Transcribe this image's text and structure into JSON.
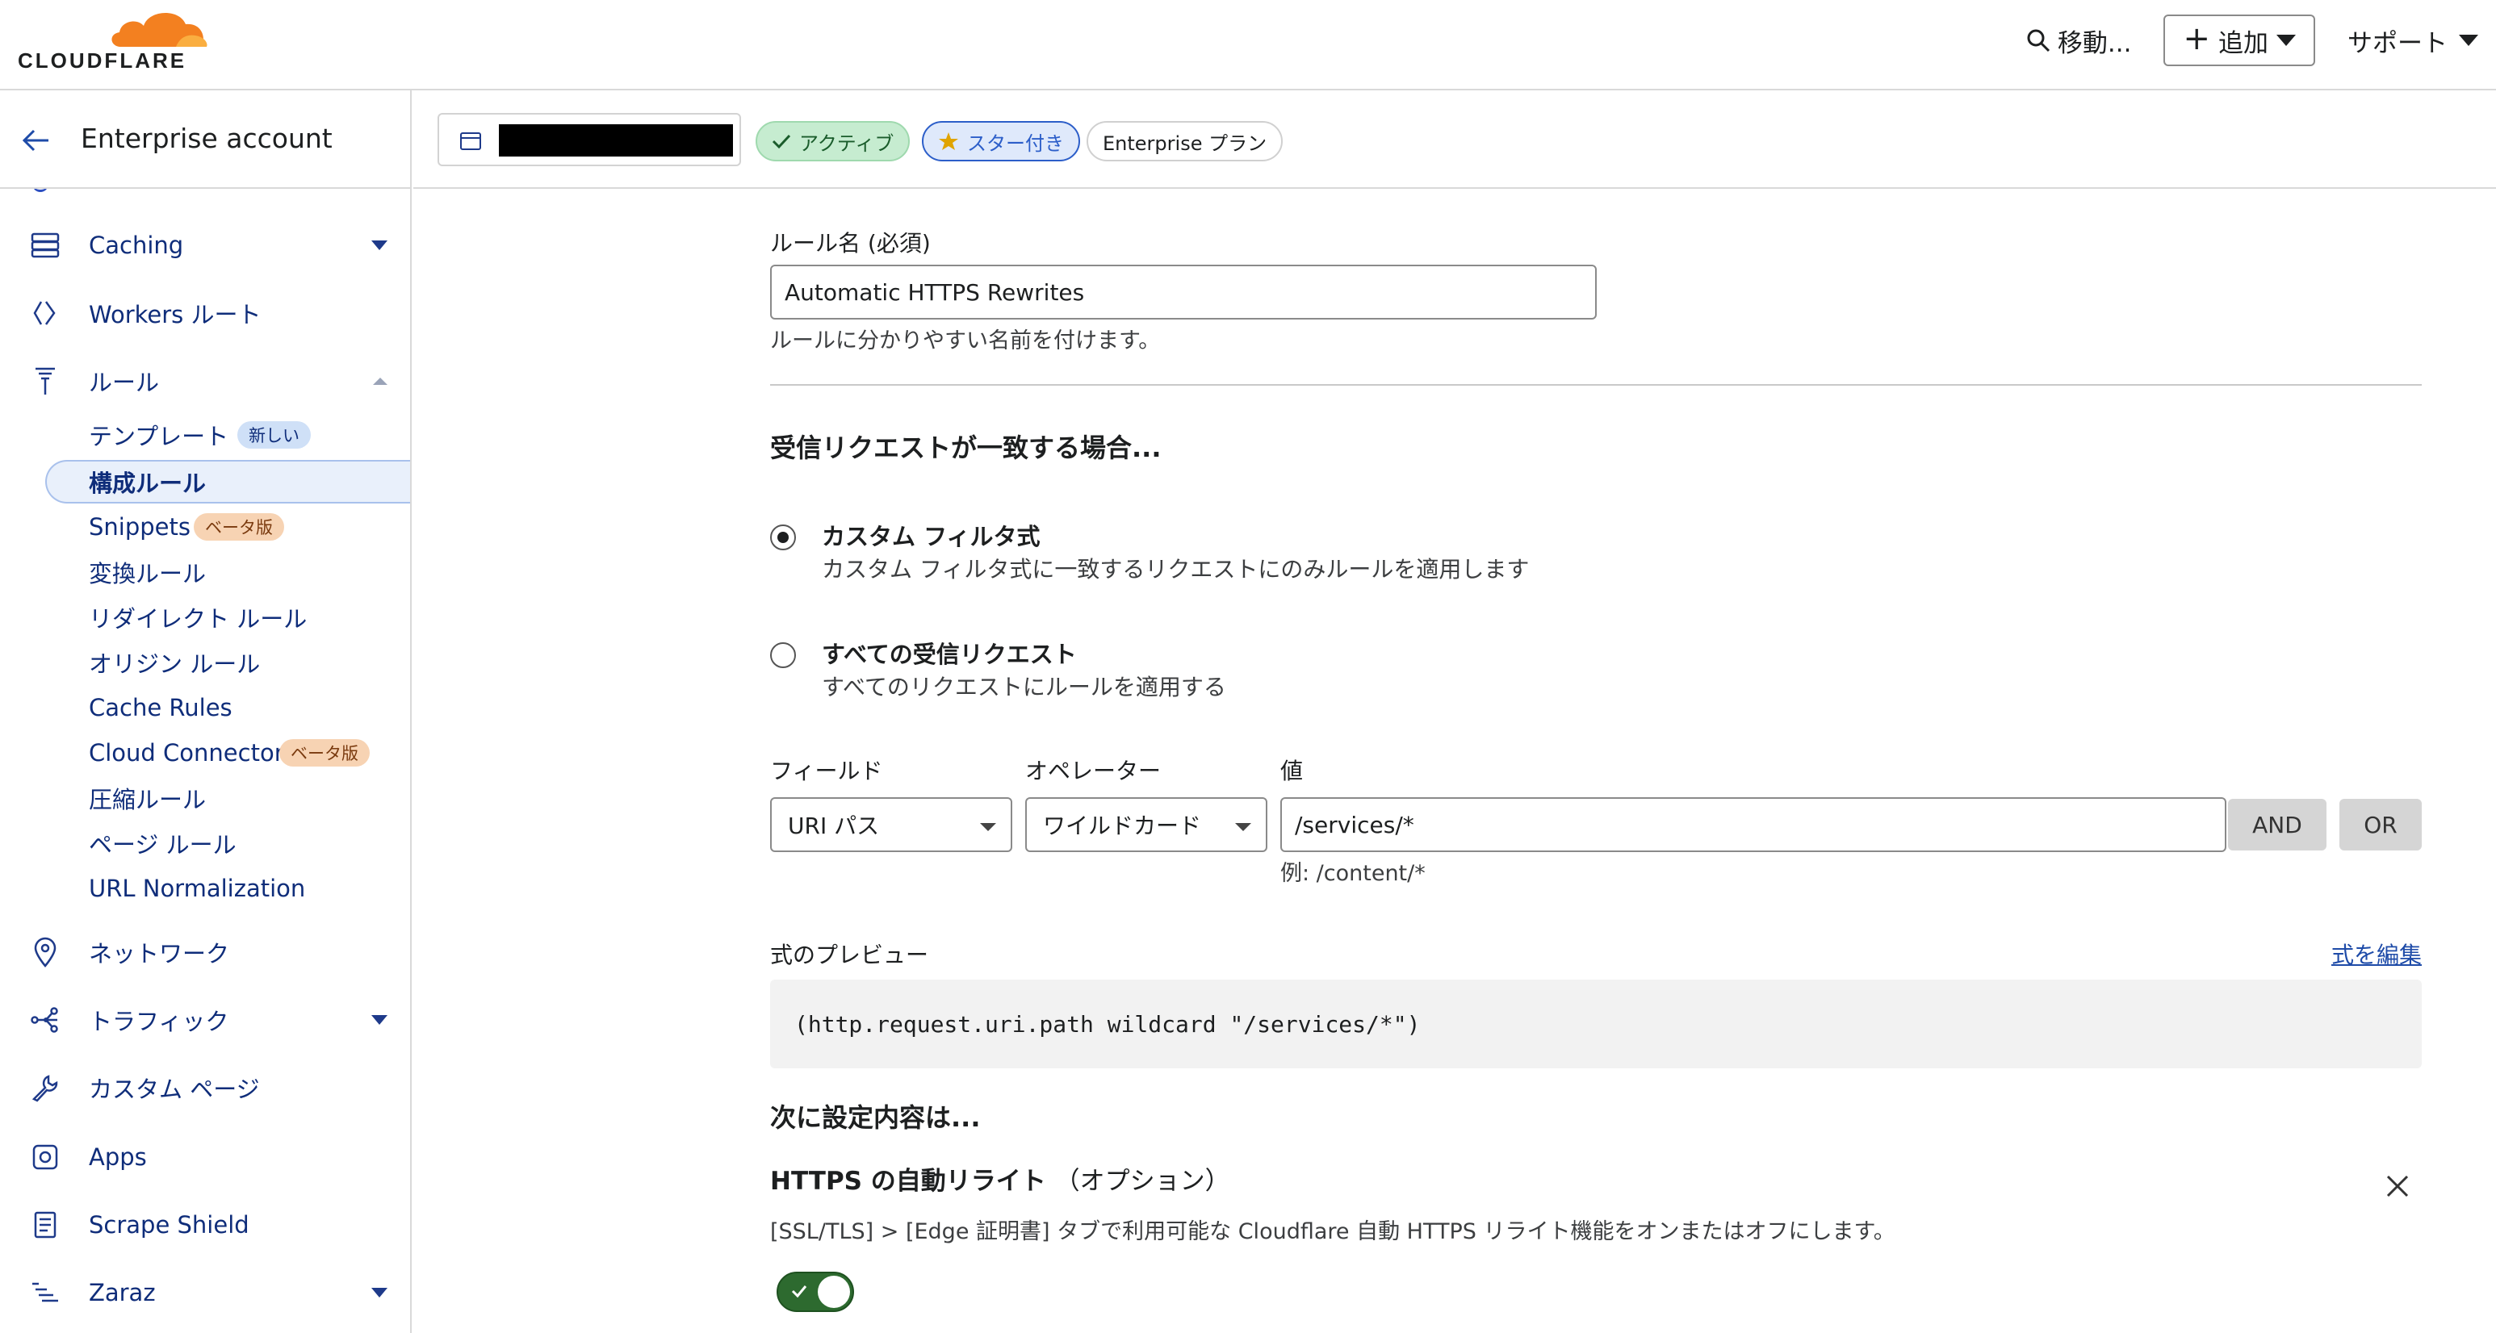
{
  "header": {
    "brand": "CLOUDFLARE",
    "goto_label": "移動...",
    "add_label": "追加",
    "support_label": "サポート"
  },
  "sidebar": {
    "account_name": "Enterprise account",
    "items": [
      {
        "label": "Caching",
        "icon": "server-stack-icon"
      },
      {
        "label": "Workers ルート",
        "icon": "workers-icon"
      },
      {
        "label": "ルール",
        "icon": "rules-funnel-icon"
      },
      {
        "label": "ネットワーク",
        "icon": "location-pin-icon"
      },
      {
        "label": "トラフィック",
        "icon": "traffic-nodes-icon"
      },
      {
        "label": "カスタム ページ",
        "icon": "wrench-icon"
      },
      {
        "label": "Apps",
        "icon": "apps-icon"
      },
      {
        "label": "Scrape Shield",
        "icon": "document-icon"
      },
      {
        "label": "Zaraz",
        "icon": "zaraz-icon"
      }
    ],
    "rules_sub": [
      {
        "label": "テンプレート",
        "badge": "新しい"
      },
      {
        "label": "構成ルール",
        "active": true
      },
      {
        "label": "Snippets",
        "badge": "ベータ版"
      },
      {
        "label": "変換ルール"
      },
      {
        "label": "リダイレクト ルール"
      },
      {
        "label": "オリジン ルール"
      },
      {
        "label": "Cache Rules"
      },
      {
        "label": "Cloud Connector",
        "badge": "ベータ版"
      },
      {
        "label": "圧縮ルール"
      },
      {
        "label": "ページ ルール"
      },
      {
        "label": "URL Normalization"
      }
    ]
  },
  "zonebar": {
    "status": "アクティブ",
    "starred": "スター付き",
    "plan": "Enterprise プラン"
  },
  "form": {
    "rule_name_label": "ルール名 (必須)",
    "rule_name_value": "Automatic HTTPS Rewrites",
    "rule_name_help": "ルールに分かりやすい名前を付けます。",
    "match_heading": "受信リクエストが一致する場合...",
    "option_custom_title": "カスタム フィルタ式",
    "option_custom_desc": "カスタム フィルタ式に一致するリクエストにのみルールを適用します",
    "option_all_title": "すべての受信リクエスト",
    "option_all_desc": "すべてのリクエストにルールを適用する",
    "field_label": "フィールド",
    "operator_label": "オペレーター",
    "value_label": "値",
    "field_value": "URI パス",
    "operator_value": "ワイルドカード",
    "value_value": "/services/*",
    "value_example": "例: /content/*",
    "and_label": "AND",
    "or_label": "OR",
    "preview_label": "式のプレビュー",
    "edit_expression": "式を編集",
    "preview_expression": "(http.request.uri.path wildcard \"/services/*\")",
    "then_heading": "次に設定内容は...",
    "setting_title": "HTTPS の自動リライト",
    "setting_optional": "（オプション）",
    "setting_desc": "[SSL/TLS] > [Edge 証明書] タブで利用可能な Cloudflare 自動 HTTPS リライト機能をオンまたはオフにします。",
    "toggle_on": true
  },
  "colors": {
    "cloudflare_orange": "#f38020",
    "nav_blue": "#0f2d7a",
    "toggle_green": "#2d6a2f"
  }
}
